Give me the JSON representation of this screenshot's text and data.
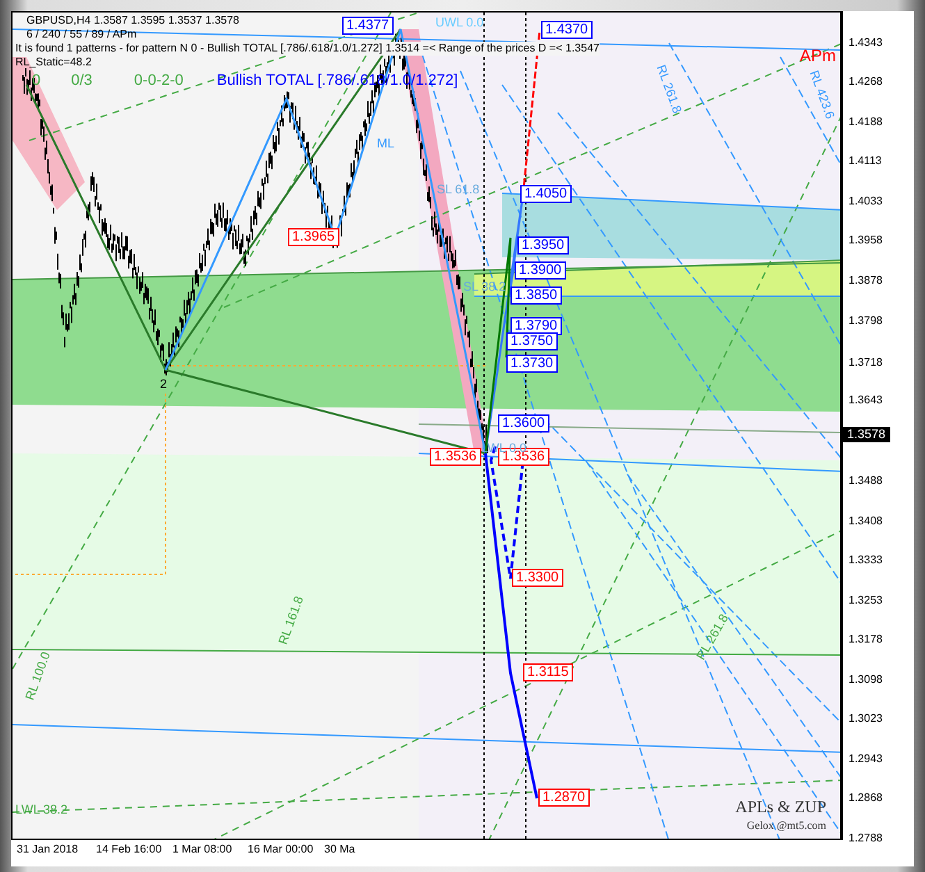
{
  "header": {
    "symbol_line": "GBPUSD,H4  1.3587 1.3595 1.3537 1.3578",
    "settings_line": "6 / 240 / 55 / 89 / APm",
    "pattern_info": "It is found 1 patterns  -  for pattern N 0 - Bullish TOTAL [.786/.618/1.0/1.272]  1.3514 =< Range of the prices D =< 1.3547",
    "rl_static": "RL_Static=48.2",
    "counters": [
      "0",
      "0/3",
      "0-0-2-0"
    ],
    "pattern_title": "Bullish TOTAL [.786/.618/1.0/1.272]"
  },
  "apm_label": "APm",
  "point_label": "2",
  "price_labels": [
    {
      "text": "1.4377",
      "color": "#0000ff"
    },
    {
      "text": "1.4370",
      "color": "#0000ff"
    },
    {
      "text": "1.4050",
      "color": "#0000ff"
    },
    {
      "text": "1.3965",
      "color": "#ff0000"
    },
    {
      "text": "1.3950",
      "color": "#0000ff"
    },
    {
      "text": "1.3900",
      "color": "#0000ff"
    },
    {
      "text": "1.3850",
      "color": "#0000ff"
    },
    {
      "text": "1.3790",
      "color": "#0000ff"
    },
    {
      "text": "1.3750",
      "color": "#0000ff"
    },
    {
      "text": "1.3730",
      "color": "#0000ff"
    },
    {
      "text": "1.3600",
      "color": "#0000ff"
    },
    {
      "text": "1.3536",
      "color": "#ff0000"
    },
    {
      "text": "1.3536",
      "color": "#ff0000"
    },
    {
      "text": "1.3300",
      "color": "#ff0000"
    },
    {
      "text": "1.3115",
      "color": "#ff0000"
    },
    {
      "text": "1.2870",
      "color": "#ff0000"
    }
  ],
  "level_labels": [
    {
      "text": "UWL 0.0",
      "color": "#66ccff"
    },
    {
      "text": "SL 61.8",
      "color": "#66aadd"
    },
    {
      "text": "SL 38.2",
      "color": "#66aadd"
    },
    {
      "text": "LWL 0.0",
      "color": "#66aadd"
    },
    {
      "text": "LWL 38.2",
      "color": "#44aa44"
    },
    {
      "text": "ML",
      "color": "#3399ff"
    },
    {
      "text": "RL 261.8",
      "color": "#3399ff"
    },
    {
      "text": "RL 423.6",
      "color": "#3399ff"
    },
    {
      "text": "RL 161.8",
      "color": "#44aa44"
    },
    {
      "text": "RL 100.0",
      "color": "#44aa44"
    },
    {
      "text": "RL 261.8",
      "color": "#44aa44"
    }
  ],
  "y_axis": [
    "1.4343",
    "1.4268",
    "1.4188",
    "1.4113",
    "1.4033",
    "1.3958",
    "1.3878",
    "1.3798",
    "1.3718",
    "1.3643",
    "1.3488",
    "1.3408",
    "1.3333",
    "1.3253",
    "1.3178",
    "1.3098",
    "1.3023",
    "1.2943",
    "1.2868",
    "1.2788"
  ],
  "current_price": "1.3578",
  "x_axis": [
    "31 Jan 2018",
    "14 Feb 16:00",
    "1 Mar 08:00",
    "16 Mar 00:00",
    "30 Ma"
  ],
  "credits": [
    "APLs & ZUP",
    "Gelox @mt5.com"
  ]
}
